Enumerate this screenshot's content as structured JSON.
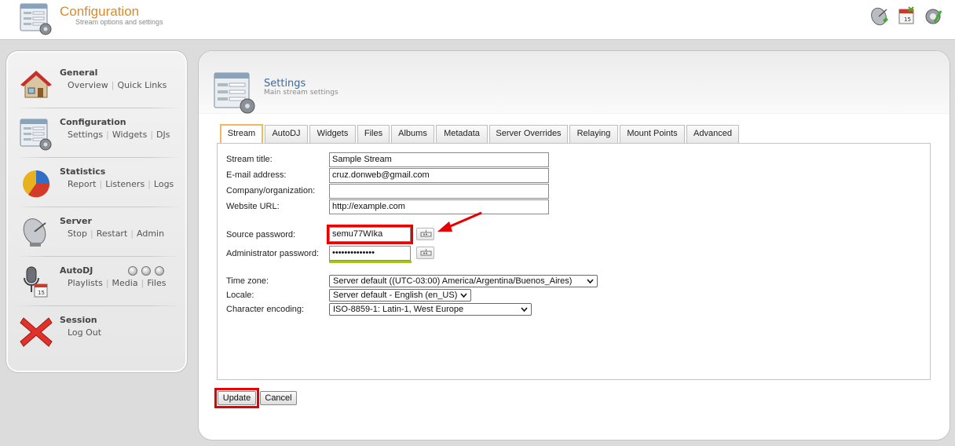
{
  "header": {
    "title": "Configuration",
    "subtitle": "Stream options and settings",
    "icons": [
      "satellite-dish-icon",
      "calendar-icon",
      "wrench-settings-icon"
    ]
  },
  "sidebar": {
    "sections": [
      {
        "title": "General",
        "icon": "house-icon",
        "links": [
          "Overview",
          "Quick Links"
        ]
      },
      {
        "title": "Configuration",
        "icon": "config-window-icon",
        "links": [
          "Settings",
          "Widgets",
          "DJs"
        ]
      },
      {
        "title": "Statistics",
        "icon": "pie-chart-icon",
        "links": [
          "Report",
          "Listeners",
          "Logs"
        ]
      },
      {
        "title": "Server",
        "icon": "satellite-dish-icon",
        "links": [
          "Stop",
          "Restart",
          "Admin"
        ]
      },
      {
        "title": "AutoDJ",
        "icon": "microphone-icon",
        "links": [
          "Playlists",
          "Media",
          "Files"
        ]
      },
      {
        "title": "Session",
        "icon": "red-x-icon",
        "links": [
          "Log Out"
        ]
      }
    ]
  },
  "main": {
    "title": "Settings",
    "subtitle": "Main stream settings",
    "tabs": [
      "Stream",
      "AutoDJ",
      "Widgets",
      "Files",
      "Albums",
      "Metadata",
      "Server Overrides",
      "Relaying",
      "Mount Points",
      "Advanced"
    ],
    "active_tab": "Stream",
    "form": {
      "stream_title_label": "Stream title:",
      "stream_title_value": "Sample Stream",
      "email_label": "E-mail address:",
      "email_value": "cruz.donweb@gmail.com",
      "company_label": "Company/organization:",
      "company_value": "",
      "website_label": "Website URL:",
      "website_value": "http://example.com",
      "source_password_label": "Source password:",
      "source_password_value": "semu77WIka",
      "admin_password_label": "Administrator password:",
      "admin_password_value": "••••••••••••••",
      "timezone_label": "Time zone:",
      "timezone_value": "Server default ((UTC-03:00) America/Argentina/Buenos_Aires)",
      "locale_label": "Locale:",
      "locale_value": "Server default - English (en_US)",
      "encoding_label": "Character encoding:",
      "encoding_value": "ISO-8859-1: Latin-1, West Europe"
    },
    "buttons": {
      "update": "Update",
      "cancel": "Cancel"
    }
  },
  "colors": {
    "accent_orange": "#e08a1e",
    "highlight_red": "#e60000",
    "strength_green": "#a8c21a",
    "settings_title_blue": "#3a6a9a"
  }
}
